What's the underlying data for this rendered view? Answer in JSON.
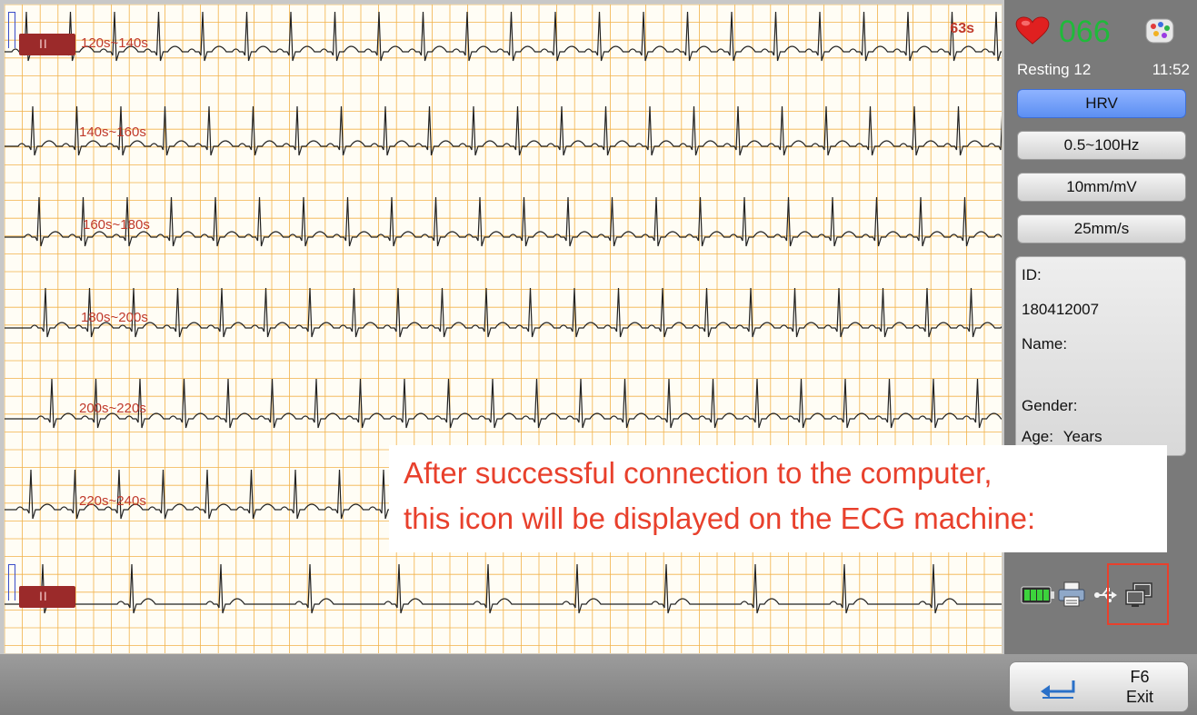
{
  "ecg": {
    "elapsed": "63s",
    "strips": [
      {
        "label": "120s~140s"
      },
      {
        "label": "140s~160s"
      },
      {
        "label": "160s~180s"
      },
      {
        "label": "180s~200s"
      },
      {
        "label": "200s~220s"
      },
      {
        "label": "220s~240s"
      },
      {
        "label": ""
      }
    ],
    "pause_label": "II",
    "grid_color": "#f2b24a",
    "trace_color": "#222222"
  },
  "status": {
    "heart_rate": "066",
    "heart_icon": "heart-icon",
    "brain_icon": "brain-icon",
    "mode": "Resting 12",
    "time": "11:52"
  },
  "controls": {
    "hrv": "HRV",
    "filter": "0.5~100Hz",
    "gain": "10mm/mV",
    "speed": "25mm/s"
  },
  "patient": {
    "id_label": "ID:",
    "id_value": "180412007",
    "name_label": "Name:",
    "name_value": "",
    "gender_label": "Gender:",
    "age_label": "Age:",
    "age_unit": "Years"
  },
  "indicators": [
    "battery-icon",
    "printer-icon",
    "usb-icon",
    "pc-connection-icon"
  ],
  "footer": {
    "exit_key": "F6",
    "exit_label": "Exit"
  },
  "annotation": {
    "line1": "After successful connection to the computer,",
    "line2": "this icon will be displayed on the ECG machine:"
  },
  "colors": {
    "heart_rate": "#1fba3a",
    "highlight": "#e8402c",
    "active_button": "#5c8ff2"
  }
}
